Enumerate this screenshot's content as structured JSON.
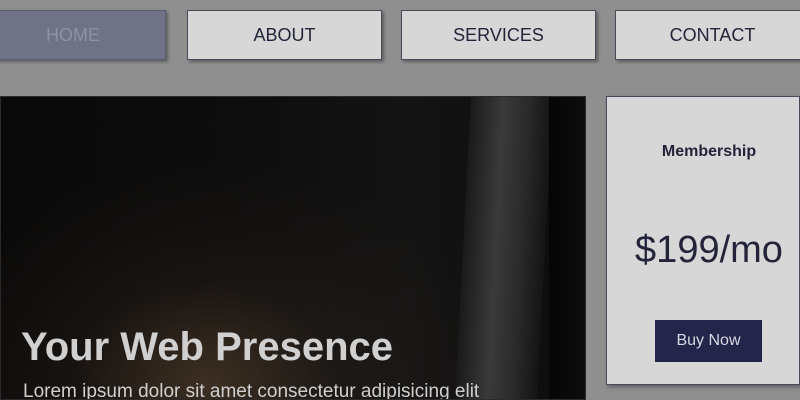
{
  "nav": {
    "items": [
      {
        "label": "HOME",
        "active": true
      },
      {
        "label": "ABOUT",
        "active": false
      },
      {
        "label": "SERVICES",
        "active": false
      },
      {
        "label": "CONTACT",
        "active": false
      }
    ]
  },
  "hero": {
    "title": "Your Web Presence",
    "text": "Lorem ipsum dolor sit amet consectetur adipisicing elit"
  },
  "pricing": {
    "title": "Membership",
    "price": "$199/mo",
    "button_label": "Buy Now"
  },
  "colors": {
    "background": "#8f8f8f",
    "nav_button": "#d7d7d7",
    "nav_active": "#6f7385",
    "accent": "#23264a",
    "text_dark": "#23243a"
  }
}
